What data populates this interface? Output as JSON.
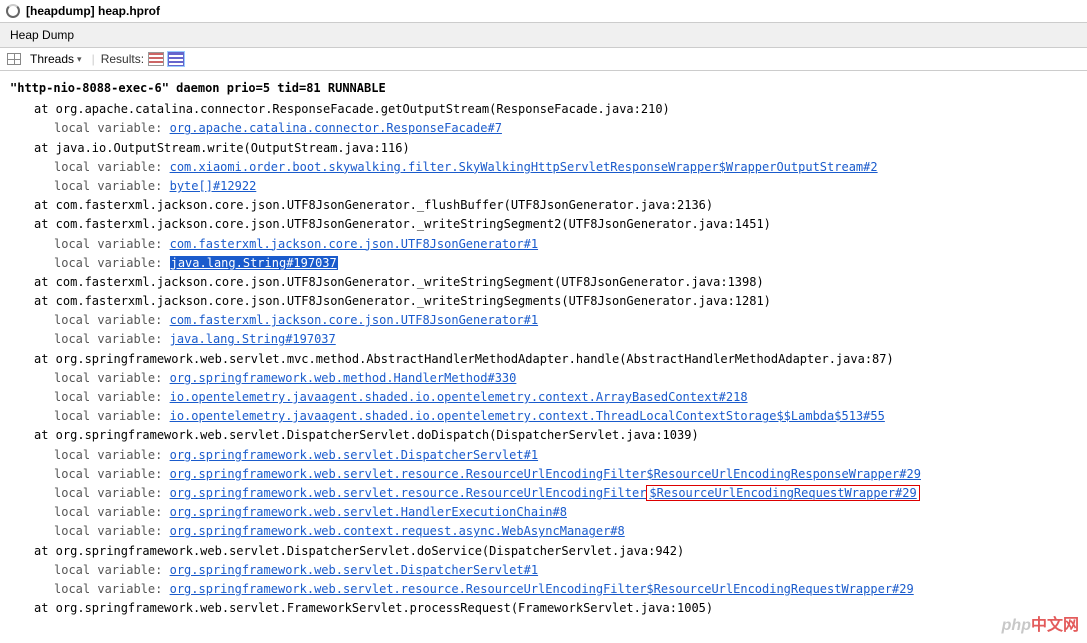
{
  "window": {
    "title": "[heapdump] heap.hprof"
  },
  "tab": {
    "label": "Heap Dump"
  },
  "toolbar": {
    "threads_label": "Threads",
    "results_label": "Results:"
  },
  "thread": {
    "header": "\"http-nio-8088-exec-6\" daemon prio=5 tid=81 RUNNABLE"
  },
  "frames": [
    {
      "at": "at org.apache.catalina.connector.ResponseFacade.getOutputStream(ResponseFacade.java:210)",
      "locals": [
        {
          "label": "local variable:",
          "link": "org.apache.catalina.connector.ResponseFacade#7"
        }
      ]
    },
    {
      "at": "at java.io.OutputStream.write(OutputStream.java:116)",
      "locals": [
        {
          "label": "local variable:",
          "link": "com.xiaomi.order.boot.skywalking.filter.SkyWalkingHttpServletResponseWrapper$WrapperOutputStream#2"
        },
        {
          "label": "local variable:",
          "link": "byte[]#12922"
        }
      ]
    },
    {
      "at": "at com.fasterxml.jackson.core.json.UTF8JsonGenerator._flushBuffer(UTF8JsonGenerator.java:2136)",
      "locals": []
    },
    {
      "at": "at com.fasterxml.jackson.core.json.UTF8JsonGenerator._writeStringSegment2(UTF8JsonGenerator.java:1451)",
      "locals": [
        {
          "label": "local variable:",
          "link": "com.fasterxml.jackson.core.json.UTF8JsonGenerator#1"
        },
        {
          "label": "local variable:",
          "link": "java.lang.String#197037",
          "highlight": true
        }
      ]
    },
    {
      "at": "at com.fasterxml.jackson.core.json.UTF8JsonGenerator._writeStringSegment(UTF8JsonGenerator.java:1398)",
      "locals": []
    },
    {
      "at": "at com.fasterxml.jackson.core.json.UTF8JsonGenerator._writeStringSegments(UTF8JsonGenerator.java:1281)",
      "locals": [
        {
          "label": "local variable:",
          "link": "com.fasterxml.jackson.core.json.UTF8JsonGenerator#1"
        },
        {
          "label": "local variable:",
          "link": "java.lang.String#197037"
        }
      ]
    },
    {
      "at": "at org.springframework.web.servlet.mvc.method.AbstractHandlerMethodAdapter.handle(AbstractHandlerMethodAdapter.java:87)",
      "locals": [
        {
          "label": "local variable:",
          "link": "org.springframework.web.method.HandlerMethod#330"
        },
        {
          "label": "local variable:",
          "link": "io.opentelemetry.javaagent.shaded.io.opentelemetry.context.ArrayBasedContext#218"
        },
        {
          "label": "local variable:",
          "link": "io.opentelemetry.javaagent.shaded.io.opentelemetry.context.ThreadLocalContextStorage$$Lambda$513#55"
        }
      ]
    },
    {
      "at": "at org.springframework.web.servlet.DispatcherServlet.doDispatch(DispatcherServlet.java:1039)",
      "locals": [
        {
          "label": "local variable:",
          "link": "org.springframework.web.servlet.DispatcherServlet#1"
        },
        {
          "label": "local variable:",
          "link": "org.springframework.web.servlet.resource.ResourceUrlEncodingFilter$ResourceUrlEncodingResponseWrapper#29"
        },
        {
          "label": "local variable:",
          "link_prefix": "org.springframework.web.servlet.resource.ResourceUrlEncodingFilter",
          "link_boxed": "$ResourceUrlEncodingRequestWrapper#29"
        },
        {
          "label": "local variable:",
          "link": "org.springframework.web.servlet.HandlerExecutionChain#8"
        },
        {
          "label": "local variable:",
          "link": "org.springframework.web.context.request.async.WebAsyncManager#8"
        }
      ]
    },
    {
      "at": "at org.springframework.web.servlet.DispatcherServlet.doService(DispatcherServlet.java:942)",
      "locals": [
        {
          "label": "local variable:",
          "link": "org.springframework.web.servlet.DispatcherServlet#1"
        },
        {
          "label": "local variable:",
          "link": "org.springframework.web.servlet.resource.ResourceUrlEncodingFilter$ResourceUrlEncodingRequestWrapper#29"
        }
      ]
    },
    {
      "at": "at org.springframework.web.servlet.FrameworkServlet.processRequest(FrameworkServlet.java:1005)",
      "locals": []
    }
  ],
  "watermark": {
    "php": "php",
    "cn": "中文网"
  }
}
